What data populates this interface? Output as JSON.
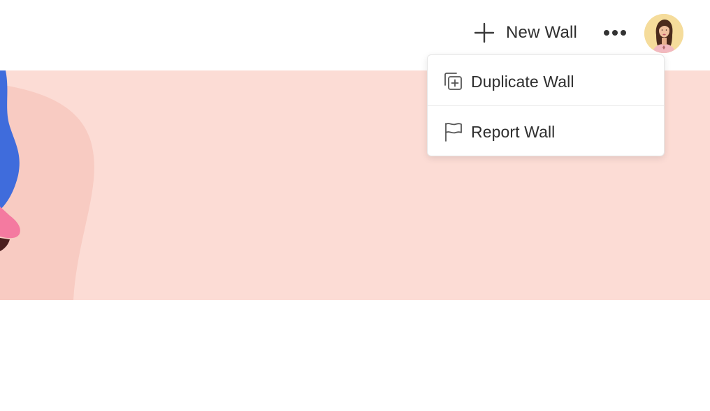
{
  "header": {
    "new_wall_label": "New Wall"
  },
  "menu": {
    "items": [
      {
        "label": "Duplicate Wall",
        "icon": "duplicate-icon"
      },
      {
        "label": "Report Wall",
        "icon": "flag-icon"
      }
    ]
  },
  "colors": {
    "banner_background": "#fcdcd5",
    "banner_shape": "#f8cbc2",
    "accent_blue": "#3f6cdc",
    "accent_pink": "#f47aa0",
    "avatar_background": "#f5dc9b"
  }
}
